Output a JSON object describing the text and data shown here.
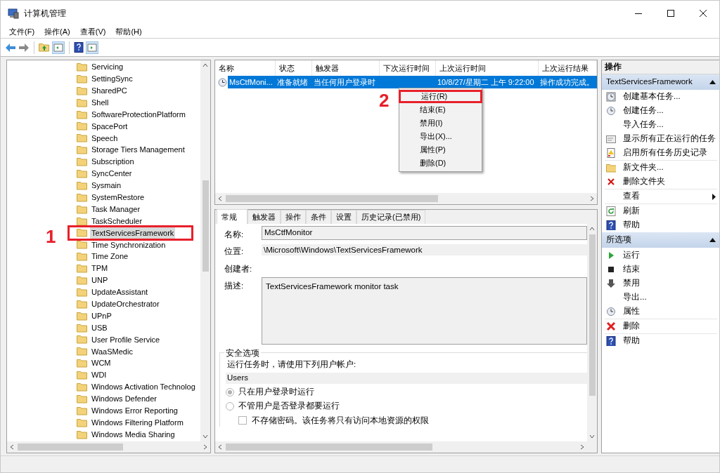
{
  "window": {
    "title": "计算机管理"
  },
  "menu": [
    "文件(F)",
    "操作(A)",
    "查看(V)",
    "帮助(H)"
  ],
  "tree": {
    "items": [
      {
        "label": "Servicing",
        "selected": false
      },
      {
        "label": "SettingSync",
        "selected": false
      },
      {
        "label": "SharedPC",
        "selected": false
      },
      {
        "label": "Shell",
        "selected": false
      },
      {
        "label": "SoftwareProtectionPlatform",
        "selected": false
      },
      {
        "label": "SpacePort",
        "selected": false
      },
      {
        "label": "Speech",
        "selected": false
      },
      {
        "label": "Storage Tiers Management",
        "selected": false
      },
      {
        "label": "Subscription",
        "selected": false
      },
      {
        "label": "SyncCenter",
        "selected": false
      },
      {
        "label": "Sysmain",
        "selected": false
      },
      {
        "label": "SystemRestore",
        "selected": false
      },
      {
        "label": "Task Manager",
        "selected": false
      },
      {
        "label": "TaskScheduler",
        "selected": false
      },
      {
        "label": "TextServicesFramework",
        "selected": true,
        "highlighted": true
      },
      {
        "label": "Time Synchronization",
        "selected": false
      },
      {
        "label": "Time Zone",
        "selected": false
      },
      {
        "label": "TPM",
        "selected": false
      },
      {
        "label": "UNP",
        "selected": false
      },
      {
        "label": "UpdateAssistant",
        "selected": false
      },
      {
        "label": "UpdateOrchestrator",
        "selected": false
      },
      {
        "label": "UPnP",
        "selected": false
      },
      {
        "label": "USB",
        "selected": false
      },
      {
        "label": "User Profile Service",
        "selected": false
      },
      {
        "label": "WaaSMedic",
        "selected": false
      },
      {
        "label": "WCM",
        "selected": false
      },
      {
        "label": "WDI",
        "selected": false
      },
      {
        "label": "Windows Activation Technolog",
        "selected": false
      },
      {
        "label": "Windows Defender",
        "selected": false
      },
      {
        "label": "Windows Error Reporting",
        "selected": false
      },
      {
        "label": "Windows Filtering Platform",
        "selected": false
      },
      {
        "label": "Windows Media Sharing",
        "selected": false
      }
    ]
  },
  "task_list": {
    "columns": [
      "名称",
      "状态",
      "触发器",
      "下次运行时间",
      "上次运行时间",
      "上次运行结果"
    ],
    "rows": [
      {
        "selected": true,
        "cells": [
          "MsCtfMoni...",
          "准备就绪",
          "当任何用户登录时",
          "",
          "10/8/27/星期二 上午 9:22:00",
          "操作成功完成。"
        ]
      }
    ]
  },
  "context_menu": {
    "items": [
      {
        "label": "运行(R)",
        "highlighted": true
      },
      {
        "label": "结束(E)",
        "highlighted": false
      },
      {
        "label": "禁用(I)",
        "highlighted": false
      },
      {
        "label": "导出(X)...",
        "highlighted": false
      },
      {
        "label": "属性(P)",
        "highlighted": false
      },
      {
        "label": "删除(D)",
        "highlighted": false
      }
    ]
  },
  "details": {
    "tabs": [
      {
        "label": "常规",
        "selected": true
      },
      {
        "label": "触发器",
        "selected": false
      },
      {
        "label": "操作",
        "selected": false
      },
      {
        "label": "条件",
        "selected": false
      },
      {
        "label": "设置",
        "selected": false
      },
      {
        "label": "历史记录(已禁用)",
        "selected": false
      }
    ],
    "fields": [
      {
        "kind": "input",
        "label": "名称:",
        "value": "MsCtfMonitor"
      },
      {
        "kind": "text",
        "label": "位置:",
        "value": "\\Microsoft\\Windows\\TextServicesFramework"
      },
      {
        "kind": "empty",
        "label": "创建者:"
      },
      {
        "kind": "textarea",
        "label": "描述:",
        "value": "TextServicesFramework monitor task"
      }
    ],
    "security": {
      "title": "安全选项",
      "prompt": "运行任务时，请使用下列用户帐户:",
      "account": "Users",
      "options": [
        {
          "label": "只在用户登录时运行",
          "selected": true
        },
        {
          "label": "不管用户是否登录都要运行",
          "selected": false
        }
      ],
      "checkbox": {
        "label": "不存储密码。该任务将只有访问本地资源的权限",
        "checked": false
      }
    }
  },
  "actions": {
    "title": "操作",
    "sections": [
      {
        "title": "TextServicesFramework",
        "expanded": true,
        "items": [
          {
            "label": "创建基本任务...",
            "separator_before": false,
            "has_submenu": false
          },
          {
            "label": "创建任务...",
            "separator_before": false,
            "has_submenu": false
          },
          {
            "label": "导入任务...",
            "separator_before": false,
            "has_submenu": false
          },
          {
            "label": "显示所有正在运行的任务",
            "separator_before": false,
            "has_submenu": false
          },
          {
            "label": "启用所有任务历史记录",
            "separator_before": false,
            "has_submenu": false
          },
          {
            "label": "新文件夹...",
            "separator_before": true,
            "has_submenu": false
          },
          {
            "label": "删除文件夹",
            "separator_before": false,
            "has_submenu": false
          },
          {
            "label": "查看",
            "separator_before": true,
            "has_submenu": true
          },
          {
            "label": "刷新",
            "separator_before": true,
            "has_submenu": false
          },
          {
            "label": "帮助",
            "separator_before": false,
            "has_submenu": false
          }
        ]
      },
      {
        "title": "所选项",
        "expanded": true,
        "items": [
          {
            "label": "运行",
            "separator_before": false,
            "has_submenu": false
          },
          {
            "label": "结束",
            "separator_before": false,
            "has_submenu": false
          },
          {
            "label": "禁用",
            "separator_before": false,
            "has_submenu": false
          },
          {
            "label": "导出...",
            "separator_before": false,
            "has_submenu": false
          },
          {
            "label": "属性",
            "separator_before": false,
            "has_submenu": false
          },
          {
            "label": "删除",
            "separator_before": true,
            "has_submenu": false
          },
          {
            "label": "帮助",
            "separator_before": true,
            "has_submenu": false
          }
        ]
      }
    ]
  },
  "annotations": [
    {
      "label": "1"
    },
    {
      "label": "2"
    }
  ]
}
